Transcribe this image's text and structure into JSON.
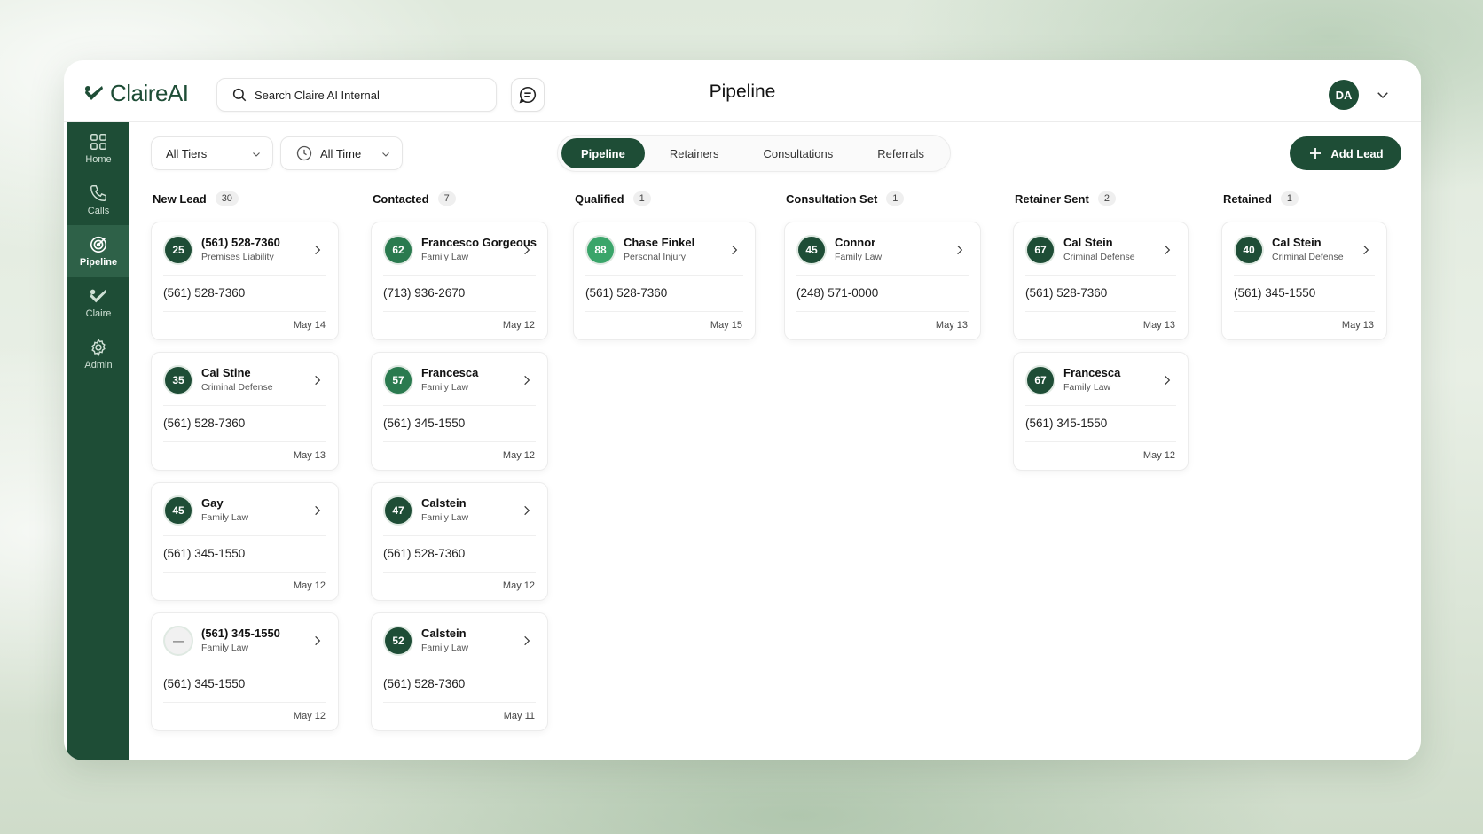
{
  "app": {
    "logo_text": "ClaireAI",
    "page_title": "Pipeline",
    "search": {
      "placeholder": "Search Claire AI Internal"
    },
    "user_initials": "DA"
  },
  "sidebar": {
    "items": [
      {
        "label": "Home",
        "icon": "grid-icon",
        "active": false
      },
      {
        "label": "Calls",
        "icon": "phone-icon",
        "active": false
      },
      {
        "label": "Pipeline",
        "icon": "target-icon",
        "active": true
      },
      {
        "label": "Claire",
        "icon": "claire-icon",
        "active": false
      },
      {
        "label": "Admin",
        "icon": "gear-icon",
        "active": false
      }
    ]
  },
  "filters": {
    "tiers": "All Tiers",
    "time": "All Time"
  },
  "tabs": [
    "Pipeline",
    "Retainers",
    "Consultations",
    "Referrals"
  ],
  "add_lead_label": "Add Lead",
  "columns": [
    {
      "title": "New Lead",
      "count": "30",
      "cards": [
        {
          "score": "25",
          "name": "(561) 528-7360",
          "type": "Premises Liability",
          "phone": "(561) 528-7360",
          "date": "May 14"
        },
        {
          "score": "35",
          "name": "Cal Stine",
          "type": "Criminal Defense",
          "phone": "(561) 528-7360",
          "date": "May 13"
        },
        {
          "score": "45",
          "name": "Gay",
          "type": "Family Law",
          "phone": "(561) 345-1550",
          "date": "May 12"
        },
        {
          "score": "—",
          "name": "(561) 345-1550",
          "type": "Family Law",
          "phone": "(561) 345-1550",
          "date": "May 12"
        }
      ]
    },
    {
      "title": "Contacted",
      "count": "7",
      "cards": [
        {
          "score": "62",
          "name": "Francesco Gorgeous",
          "type": "Family Law",
          "phone": "(713) 936-2670",
          "date": "May 12"
        },
        {
          "score": "57",
          "name": "Francesca",
          "type": "Family Law",
          "phone": "(561) 345-1550",
          "date": "May 12"
        },
        {
          "score": "47",
          "name": "Calstein",
          "type": "Family Law",
          "phone": "(561) 528-7360",
          "date": "May 12"
        },
        {
          "score": "52",
          "name": "Calstein",
          "type": "Family Law",
          "phone": "(561) 528-7360",
          "date": "May 11"
        }
      ]
    },
    {
      "title": "Qualified",
      "count": "1",
      "cards": [
        {
          "score": "88",
          "name": "Chase Finkel",
          "type": "Personal Injury",
          "phone": "(561) 528-7360",
          "date": "May 15"
        }
      ]
    },
    {
      "title": "Consultation Set",
      "count": "1",
      "cards": [
        {
          "score": "45",
          "name": "Connor",
          "type": "Family Law",
          "phone": "(248) 571-0000",
          "date": "May 13"
        }
      ]
    },
    {
      "title": "Retainer Sent",
      "count": "2",
      "cards": [
        {
          "score": "67",
          "name": "Cal Stein",
          "type": "Criminal Defense",
          "phone": "(561) 528-7360",
          "date": "May 13"
        },
        {
          "score": "67",
          "name": "Francesca",
          "type": "Family Law",
          "phone": "(561) 345-1550",
          "date": "May 12"
        }
      ]
    },
    {
      "title": "Retained",
      "count": "1",
      "cards": [
        {
          "score": "40",
          "name": "Cal Stein",
          "type": "Criminal Defense",
          "phone": "(561) 345-1550",
          "date": "May 13"
        }
      ]
    }
  ],
  "colors": {
    "brand": "#1e4d36",
    "brand_light": "#2e6148",
    "accent_green": "#3aa56a"
  }
}
